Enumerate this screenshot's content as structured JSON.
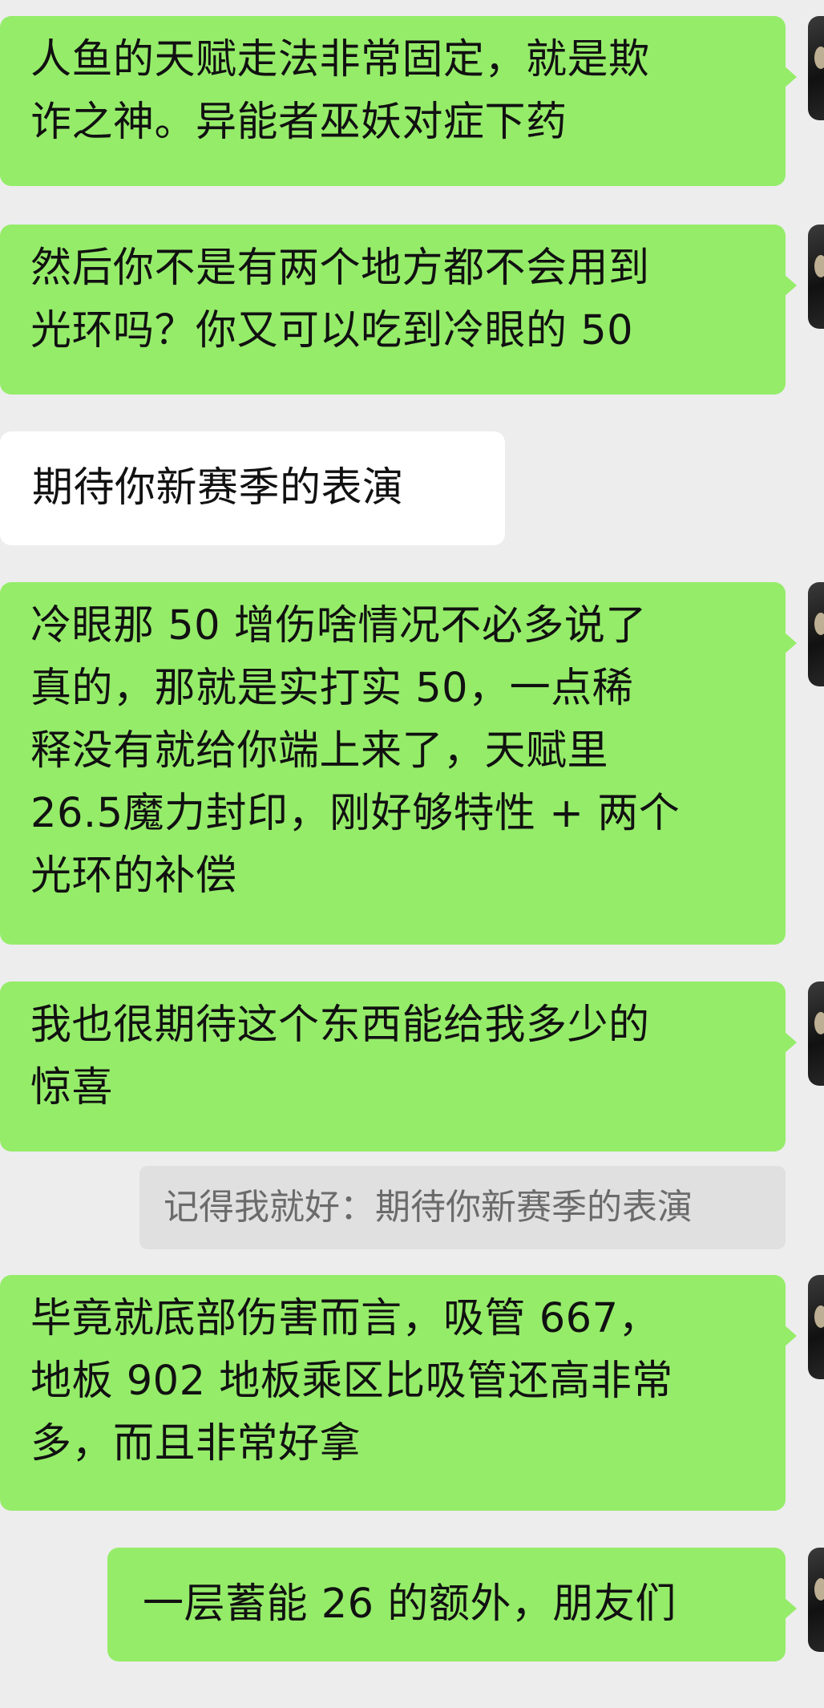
{
  "messages": [
    {
      "lines": [
        "人鱼的天赋走法非常固定，就是欺",
        "诈之神。异能者巫妖对症下药"
      ]
    },
    {
      "lines": [
        "然后你不是有两个地方都不会用到",
        "光环吗？你又可以吃到冷眼的 50"
      ]
    },
    {
      "lines": [
        "期待你新赛季的表演"
      ]
    },
    {
      "lines": [
        "冷眼那 50 增伤啥情况不必多说了",
        "真的，那就是实打实 50，一点稀",
        "释没有就给你端上来了，天赋里",
        "26.5魔力封印，刚好够特性 + 两个",
        "光环的补偿"
      ]
    },
    {
      "lines": [
        "我也很期待这个东西能给我多少的",
        "惊喜"
      ]
    },
    {
      "quote": "记得我就好：期待你新赛季的表演"
    },
    {
      "lines": [
        "毕竟就底部伤害而言，吸管 667，",
        "地板 902 地板乘区比吸管还高非常",
        "多，而且非常好拿"
      ]
    },
    {
      "lines": [
        "一层蓄能 26 的额外，朋友们"
      ]
    }
  ],
  "colors": {
    "background": "#ededed",
    "sent_bubble": "#95ec69",
    "received_bubble": "#ffffff",
    "quote_bubble": "#e0e0e0"
  }
}
